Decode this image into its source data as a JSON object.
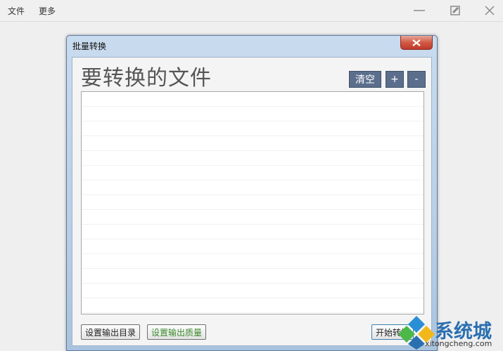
{
  "menubar": {
    "items": [
      {
        "label": "文件"
      },
      {
        "label": "更多"
      }
    ]
  },
  "dialog": {
    "title": "批量转换",
    "heading": "要转换的文件",
    "clear_label": "清空",
    "add_label": "+",
    "remove_label": "-",
    "set_output_dir_label": "设置输出目录",
    "set_output_quality_label": "设置输出质量",
    "start_label": "开始转换"
  },
  "watermark": {
    "brand": "系统城",
    "url": "xitongcheng.com"
  },
  "colors": {
    "tool_button": "#5b6f8d",
    "quality_text": "#3a8a2a",
    "watermark_blue": "#2a6fb0"
  }
}
